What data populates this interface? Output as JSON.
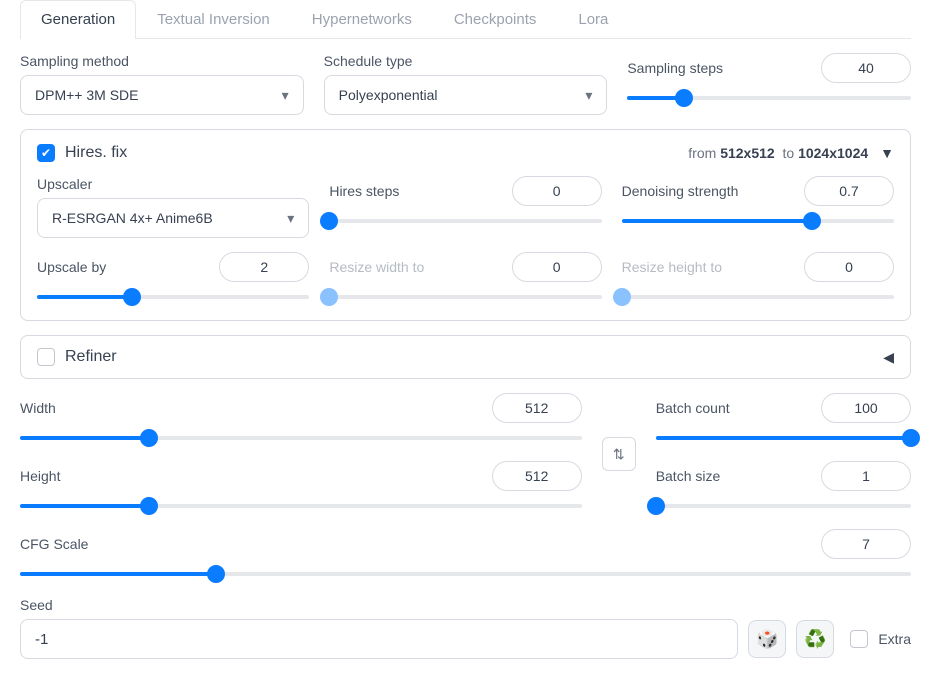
{
  "tabs": [
    "Generation",
    "Textual Inversion",
    "Hypernetworks",
    "Checkpoints",
    "Lora"
  ],
  "sampling_method": {
    "label": "Sampling method",
    "value": "DPM++ 3M SDE"
  },
  "schedule_type": {
    "label": "Schedule type",
    "value": "Polyexponential"
  },
  "sampling_steps": {
    "label": "Sampling steps",
    "value": "40",
    "pct": 20
  },
  "hires": {
    "title": "Hires. fix",
    "checked": true,
    "dim_prefix": "from",
    "dim_from": "512x512",
    "dim_mid": "to",
    "dim_to": "1024x1024",
    "upscaler": {
      "label": "Upscaler",
      "value": "R-ESRGAN 4x+ Anime6B"
    },
    "hires_steps": {
      "label": "Hires steps",
      "value": "0",
      "pct": 0
    },
    "denoise": {
      "label": "Denoising strength",
      "value": "0.7",
      "pct": 70
    },
    "upscale_by": {
      "label": "Upscale by",
      "value": "2",
      "pct": 35
    },
    "resize_w": {
      "label": "Resize width to",
      "value": "0",
      "pct": 0
    },
    "resize_h": {
      "label": "Resize height to",
      "value": "0",
      "pct": 0
    }
  },
  "refiner": {
    "title": "Refiner",
    "checked": false
  },
  "width": {
    "label": "Width",
    "value": "512",
    "pct": 23
  },
  "height": {
    "label": "Height",
    "value": "512",
    "pct": 23
  },
  "batch_count": {
    "label": "Batch count",
    "value": "100",
    "pct": 100
  },
  "batch_size": {
    "label": "Batch size",
    "value": "1",
    "pct": 0
  },
  "cfg": {
    "label": "CFG Scale",
    "value": "7",
    "pct": 22
  },
  "seed": {
    "label": "Seed",
    "value": "-1",
    "extra_label": "Extra"
  }
}
